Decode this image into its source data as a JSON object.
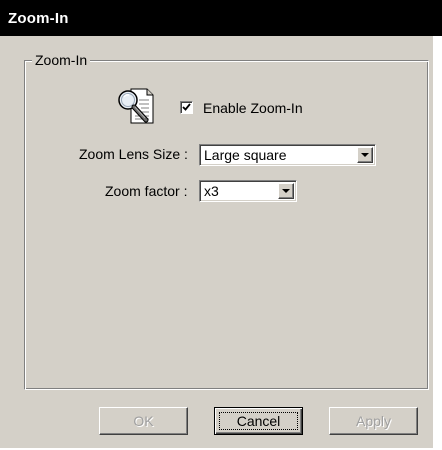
{
  "window": {
    "title": "Zoom-In"
  },
  "group": {
    "legend": "Zoom-In"
  },
  "enable_zoom": {
    "label": "Enable Zoom-In",
    "checked": true
  },
  "lens_size": {
    "label": "Zoom Lens Size :",
    "value": "Large square"
  },
  "zoom_factor": {
    "label": "Zoom factor :",
    "value": "x3"
  },
  "buttons": {
    "ok": "OK",
    "cancel": "Cancel",
    "apply": "Apply"
  },
  "icons": {
    "zoom": "magnifier-document-icon",
    "checkbox": "checkmark-icon",
    "dropdown": "chevron-down-icon"
  }
}
